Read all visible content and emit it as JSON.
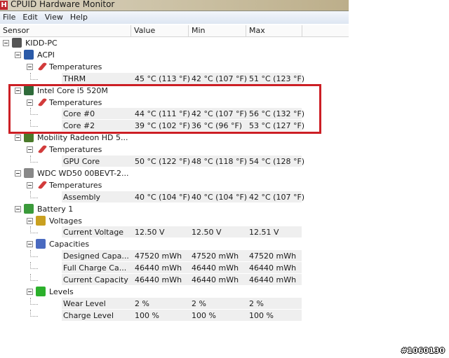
{
  "window": {
    "title": "CPUID Hardware Monitor",
    "logo": "H"
  },
  "menu": [
    "File",
    "Edit",
    "View",
    "Help"
  ],
  "columns": [
    "Sensor",
    "Value",
    "Min",
    "Max"
  ],
  "rows": [
    {
      "level": 0,
      "label": "KIDD-PC",
      "icon": "computer-icon"
    },
    {
      "level": 1,
      "label": "ACPI",
      "icon": "acpi-icon"
    },
    {
      "level": 2,
      "label": "Temperatures",
      "icon": "thermometer-icon"
    },
    {
      "level": 3,
      "label": "THRM",
      "value": "45 °C  (113 °F)",
      "min": "42 °C  (107 °F)",
      "max": "51 °C  (123 °F)"
    },
    {
      "level": 1,
      "label": "Intel Core i5 520M",
      "icon": "cpu-icon"
    },
    {
      "level": 2,
      "label": "Temperatures",
      "icon": "thermometer-icon"
    },
    {
      "level": 3,
      "label": "Core #0",
      "value": "44 °C  (111 °F)",
      "min": "42 °C  (107 °F)",
      "max": "56 °C  (132 °F)"
    },
    {
      "level": 3,
      "label": "Core #2",
      "value": "39 °C  (102 °F)",
      "min": "36 °C  (96 °F)",
      "max": "53 °C  (127 °F)"
    },
    {
      "level": 1,
      "label": "Mobility Radeon HD 5...",
      "icon": "gpu-icon"
    },
    {
      "level": 2,
      "label": "Temperatures",
      "icon": "thermometer-icon"
    },
    {
      "level": 3,
      "label": "GPU Core",
      "value": "50 °C  (122 °F)",
      "min": "48 °C  (118 °F)",
      "max": "54 °C  (128 °F)"
    },
    {
      "level": 1,
      "label": "WDC WD50 00BEVT-2...",
      "icon": "hdd-icon"
    },
    {
      "level": 2,
      "label": "Temperatures",
      "icon": "thermometer-icon"
    },
    {
      "level": 3,
      "label": "Assembly",
      "value": "40 °C  (104 °F)",
      "min": "40 °C  (104 °F)",
      "max": "42 °C  (107 °F)"
    },
    {
      "level": 1,
      "label": "Battery 1",
      "icon": "battery-icon"
    },
    {
      "level": 2,
      "label": "Voltages",
      "icon": "voltage-icon"
    },
    {
      "level": 3,
      "label": "Current Voltage",
      "value": "12.50 V",
      "min": "12.50 V",
      "max": "12.51 V"
    },
    {
      "level": 2,
      "label": "Capacities",
      "icon": "capacity-icon"
    },
    {
      "level": 3,
      "label": "Designed Capa...",
      "value": "47520 mWh",
      "min": "47520 mWh",
      "max": "47520 mWh"
    },
    {
      "level": 3,
      "label": "Full Charge Ca...",
      "value": "46440 mWh",
      "min": "46440 mWh",
      "max": "46440 mWh"
    },
    {
      "level": 3,
      "label": "Current Capacity",
      "value": "46440 mWh",
      "min": "46440 mWh",
      "max": "46440 mWh"
    },
    {
      "level": 2,
      "label": "Levels",
      "icon": "levels-icon"
    },
    {
      "level": 3,
      "label": "Wear Level",
      "value": "2 %",
      "min": "2 %",
      "max": "2 %"
    },
    {
      "level": 3,
      "label": "Charge Level",
      "value": "100 %",
      "min": "100 %",
      "max": "100 %"
    }
  ],
  "watermark": "#1060130",
  "colors": {
    "highlight": "#cc1f25"
  }
}
